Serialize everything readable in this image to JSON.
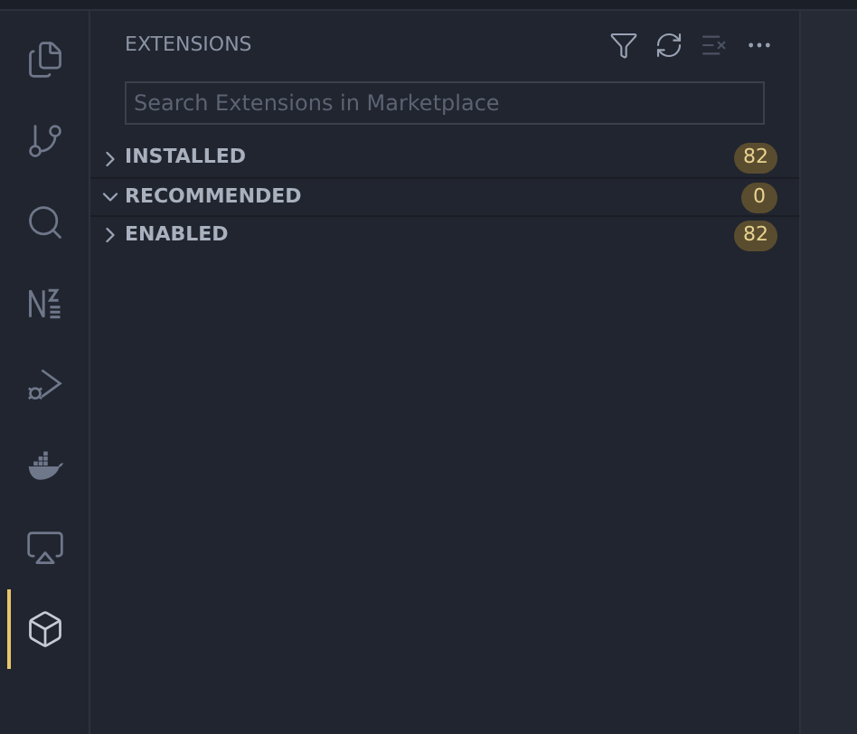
{
  "activity_bar": [
    {
      "kind": "explorer",
      "selected": false
    },
    {
      "kind": "source-control",
      "selected": false
    },
    {
      "kind": "search",
      "selected": false
    },
    {
      "kind": "n2",
      "selected": false
    },
    {
      "kind": "run-debug",
      "selected": false
    },
    {
      "kind": "docker",
      "selected": false
    },
    {
      "kind": "remote",
      "selected": false
    },
    {
      "kind": "extensions",
      "selected": true
    }
  ],
  "sidebar": {
    "title": "EXTENSIONS",
    "actions": [
      {
        "kind": "filter",
        "disabled": false
      },
      {
        "kind": "refresh",
        "disabled": false
      },
      {
        "kind": "clear",
        "disabled": true
      },
      {
        "kind": "more",
        "disabled": false
      }
    ],
    "search": {
      "placeholder": "Search Extensions in Marketplace"
    },
    "sections": [
      {
        "label": "INSTALLED",
        "expanded": false,
        "count": "82"
      },
      {
        "label": "RECOMMENDED",
        "expanded": true,
        "count": "0"
      },
      {
        "label": "ENABLED",
        "expanded": false,
        "count": "82"
      }
    ]
  }
}
